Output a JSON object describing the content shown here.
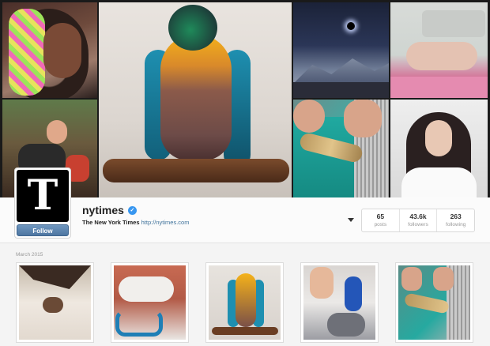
{
  "profile": {
    "username": "nytimes",
    "full_name": "The New York Times",
    "website": "http://nytimes.com",
    "avatar_glyph": "T",
    "follow_label": "Follow",
    "verified_glyph": "✓"
  },
  "stats": [
    {
      "value": "65",
      "label": "posts"
    },
    {
      "value": "43.6k",
      "label": "followers"
    },
    {
      "value": "263",
      "label": "following"
    }
  ],
  "feed": {
    "month_label": "March 2015"
  },
  "colors": {
    "follow_button": "#4e76a1",
    "link": "#3f729b",
    "verified_badge": "#3897f0"
  }
}
